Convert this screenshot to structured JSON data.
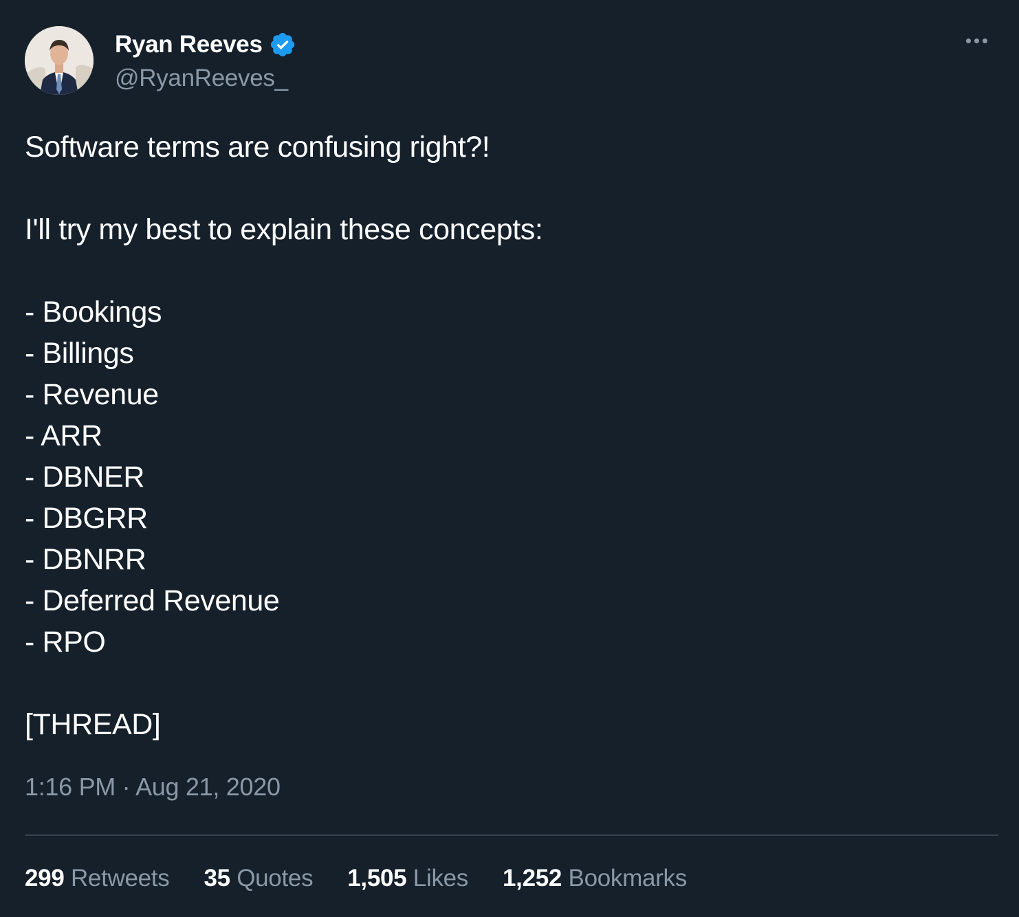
{
  "author": {
    "display_name": "Ryan Reeves",
    "handle": "@RyanReeves_",
    "verified_icon": "verified-badge-icon",
    "avatar_icon": "profile-photo"
  },
  "menu_icon": "more-options-icon",
  "tweet": {
    "lines": [
      "Software terms are confusing right?!",
      "",
      "I'll try my best to explain these concepts:",
      "",
      "- Bookings",
      "- Billings",
      "- Revenue",
      "- ARR",
      "- DBNER",
      "- DBGRR",
      "- DBNRR",
      "- Deferred Revenue",
      "- RPO",
      "",
      "[THREAD]"
    ],
    "timestamp": "1:16 PM · Aug 21, 2020"
  },
  "stats": {
    "retweets": {
      "count": "299",
      "label": "Retweets"
    },
    "quotes": {
      "count": "35",
      "label": "Quotes"
    },
    "likes": {
      "count": "1,505",
      "label": "Likes"
    },
    "bookmarks": {
      "count": "1,252",
      "label": "Bookmarks"
    }
  },
  "colors": {
    "background": "#15202b",
    "text": "#ffffff",
    "secondary": "#8b98a5",
    "verified": "#1d9bf0",
    "divider": "#38444d"
  }
}
